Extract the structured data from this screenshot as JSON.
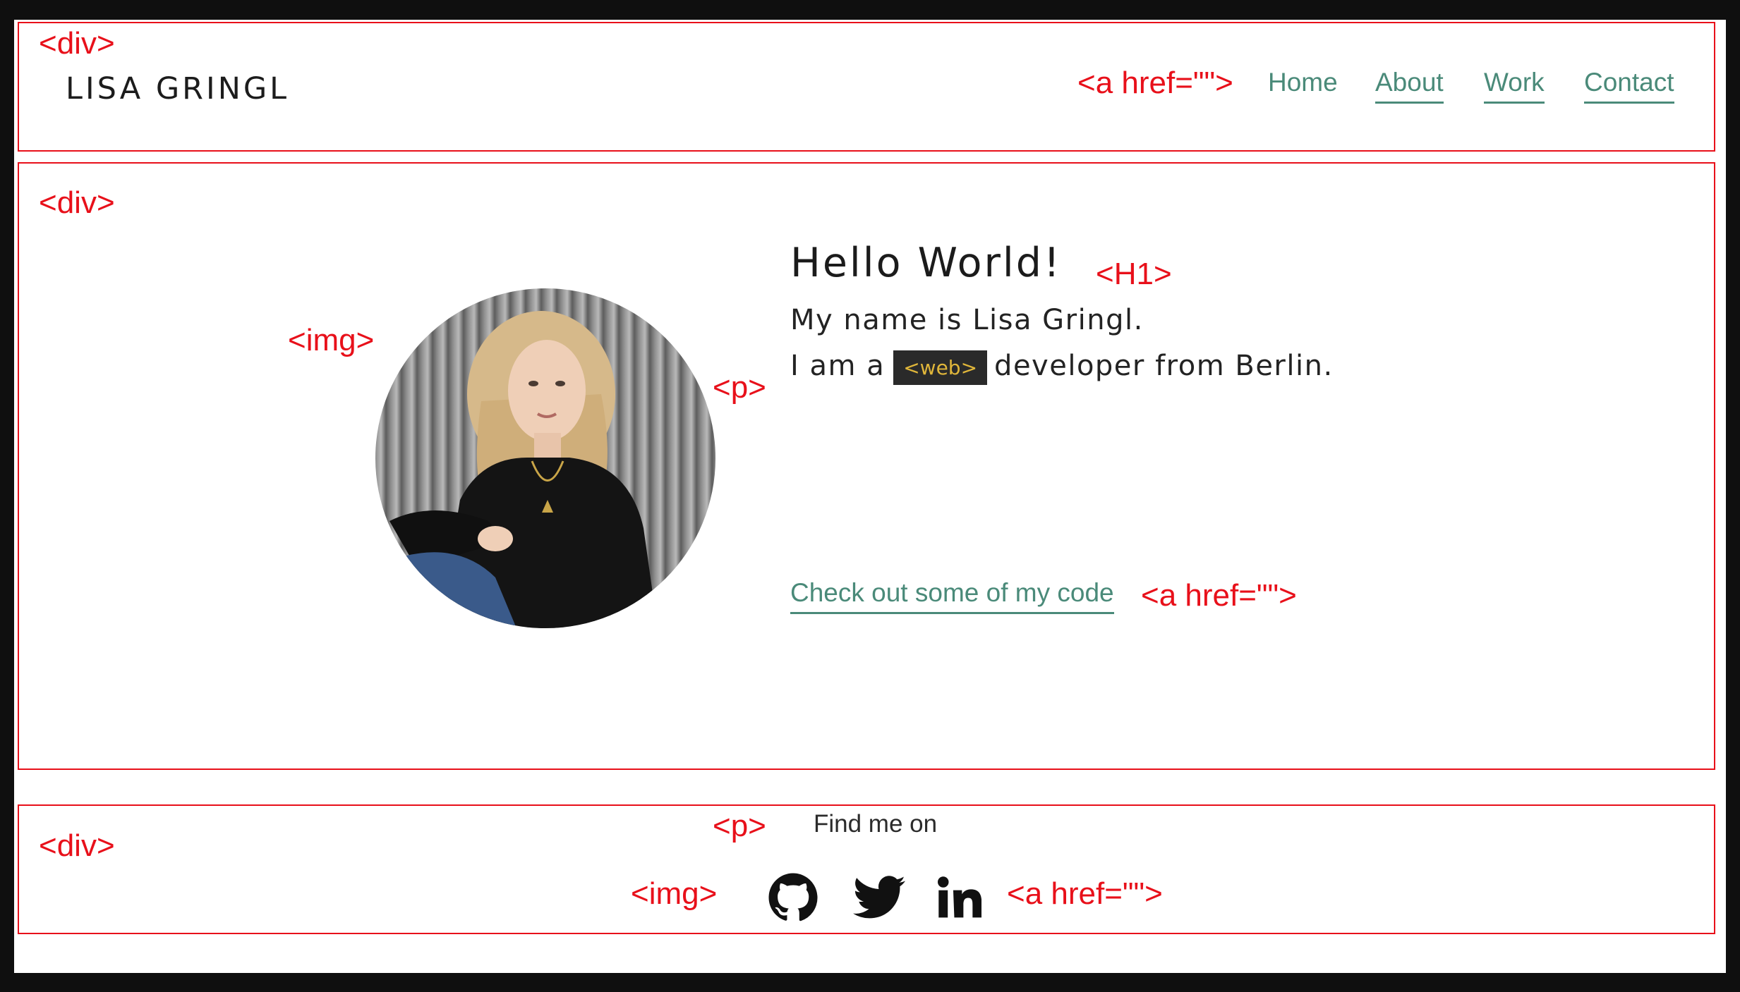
{
  "header": {
    "logo": "LISA GRINGL",
    "nav": {
      "home": "Home",
      "about": "About",
      "work": "Work",
      "contact": "Contact"
    }
  },
  "hero": {
    "heading": "Hello World!",
    "line1": "My name is Lisa Gringl.",
    "line2_prefix": "I am a",
    "code_badge": "<web>",
    "line2_suffix": "developer from Berlin.",
    "cta": "Check out some of my code"
  },
  "footer": {
    "find_me": "Find me on",
    "socials": [
      "github-icon",
      "twitter-icon",
      "linkedin-icon"
    ]
  },
  "annotations": {
    "div": "<div>",
    "anchor": "<a href=\"\">",
    "img": "<img>",
    "h1": "<H1>",
    "p": "<p>"
  },
  "colors": {
    "annotation": "#e8101a",
    "link": "#4a8a79",
    "badge_bg": "#2a2a2a",
    "badge_text": "#e0b63a",
    "frame": "#0f0f0f"
  }
}
